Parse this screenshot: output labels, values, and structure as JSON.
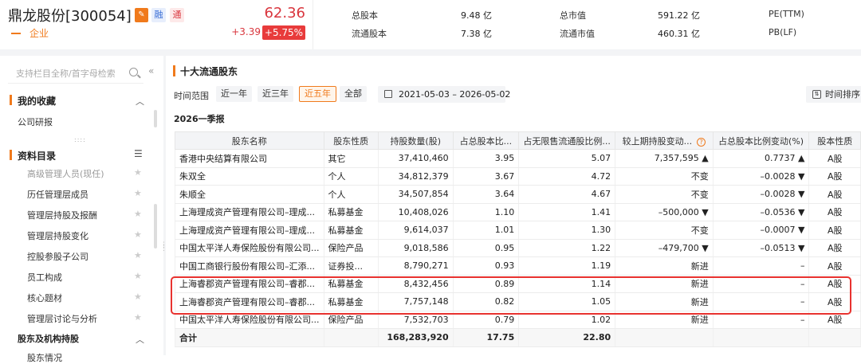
{
  "header": {
    "stock_name": "鼎龙股份[300054]",
    "tags": [
      "融",
      "通"
    ],
    "company_type": "企业",
    "price": "62.36",
    "change": "+3.39",
    "change_pct": "+5.75%",
    "stats": [
      {
        "label": "总股本",
        "value": "9.48 亿"
      },
      {
        "label": "流通股本",
        "value": "7.38 亿"
      },
      {
        "label": "总市值",
        "value": "591.22 亿"
      },
      {
        "label": "流通市值",
        "value": "460.31 亿"
      },
      {
        "label": "PE(TTM)",
        "value": ""
      },
      {
        "label": "PB(LF)",
        "value": ""
      }
    ],
    "colors": {
      "up": "#d9363e",
      "accent": "#f07a1c"
    }
  },
  "sidebar": {
    "search_placeholder": "支持栏目全称/首字母检索",
    "favorites_title": "我的收藏",
    "favorites_items": [
      "公司研报"
    ],
    "catalog_title": "资料目录",
    "catalog_items": [
      "高级管理人员(现任)",
      "历任管理层成员",
      "管理层持股及报酬",
      "管理层持股变化",
      "控股参股子公司",
      "员工构成",
      "核心题材",
      "管理层讨论与分析"
    ],
    "section3_title": "股东及机构持股",
    "section3_items": [
      "股东情况"
    ]
  },
  "main": {
    "title": "十大流通股东",
    "range_label": "时间范围",
    "range_options": [
      "近一年",
      "近三年",
      "近五年",
      "全部"
    ],
    "range_selected": "近五年",
    "date_range": "2021-05-03  –  2026-05-02",
    "sort_label": "时间排序",
    "period": "2026一季报",
    "columns": [
      "股东名称",
      "股东性质",
      "持股数量(股)",
      "占总股本比...",
      "占无限售流通股比例...",
      "较上期持股变动...",
      "占总股本比例变动(%)",
      "股本性质"
    ],
    "rows": [
      [
        "香港中央结算有限公司",
        "其它",
        "37,410,460",
        "3.95",
        "5.07",
        "7,357,595 ▲",
        "0.7737 ▲",
        "A股"
      ],
      [
        "朱双全",
        "个人",
        "34,812,379",
        "3.67",
        "4.72",
        "不变",
        "–0.0028 ▼",
        "A股"
      ],
      [
        "朱顺全",
        "个人",
        "34,507,854",
        "3.64",
        "4.67",
        "不变",
        "–0.0028 ▼",
        "A股"
      ],
      [
        "上海理成资产管理有限公司–理成...",
        "私募基金",
        "10,408,026",
        "1.10",
        "1.41",
        "–500,000 ▼",
        "–0.0536 ▼",
        "A股"
      ],
      [
        "上海理成资产管理有限公司–理成...",
        "私募基金",
        "9,614,037",
        "1.01",
        "1.30",
        "不变",
        "–0.0007 ▼",
        "A股"
      ],
      [
        "中国太平洋人寿保险股份有限公司...",
        "保险产品",
        "9,018,586",
        "0.95",
        "1.22",
        "–479,700 ▼",
        "–0.0513 ▼",
        "A股"
      ],
      [
        "中国工商银行股份有限公司–汇添...",
        "证券投...",
        "8,790,271",
        "0.93",
        "1.19",
        "新进",
        "–",
        "A股"
      ],
      [
        "上海睿郡资产管理有限公司–睿郡...",
        "私募基金",
        "8,432,456",
        "0.89",
        "1.14",
        "新进",
        "–",
        "A股"
      ],
      [
        "上海睿郡资产管理有限公司–睿郡...",
        "私募基金",
        "7,757,148",
        "0.82",
        "1.05",
        "新进",
        "–",
        "A股"
      ],
      [
        "中国太平洋人寿保险股份有限公司...",
        "保险产品",
        "7,532,703",
        "0.79",
        "1.02",
        "新进",
        "–",
        "A股"
      ]
    ],
    "total": [
      "合计",
      "",
      "168,283,920",
      "17.75",
      "22.80",
      "",
      "",
      ""
    ]
  }
}
